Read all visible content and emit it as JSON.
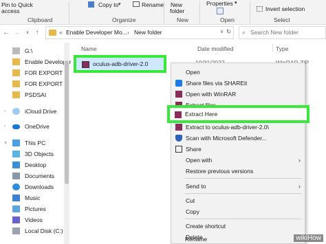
{
  "ribbon": {
    "pin_label": "Pin to Quick",
    "access_label": "access",
    "copy_to": "Copy to",
    "rename": "Rename",
    "new_label": "New",
    "folder_label": "folder",
    "properties": "Properties",
    "invert_selection": "Invert selection",
    "groups": {
      "clipboard": "Clipboard",
      "organize": "Organize",
      "new": "New",
      "open": "Open",
      "select": "Select"
    }
  },
  "address": {
    "crumb1": "Enable Developer Mo...",
    "crumb2": "New folder",
    "search_placeholder": "Search New folder"
  },
  "columns": {
    "name": "Name",
    "date_modified": "Date modified",
    "type": "Type",
    "date_value": "10/31/2022 ...",
    "type_value": "WinRAR ZIP archive"
  },
  "sidebar": {
    "items": [
      {
        "label": "G:\\"
      },
      {
        "label": "Enable Developer"
      },
      {
        "label": "FOR EXPORT"
      },
      {
        "label": "FOR EXPORT"
      },
      {
        "label": "PSDSAI"
      },
      {
        "label": "iCloud Drive"
      },
      {
        "label": "OneDrive"
      },
      {
        "label": "This PC"
      },
      {
        "label": "3D Objects"
      },
      {
        "label": "Desktop"
      },
      {
        "label": "Documents"
      },
      {
        "label": "Downloads"
      },
      {
        "label": "Music"
      },
      {
        "label": "Pictures"
      },
      {
        "label": "Videos"
      },
      {
        "label": "Local Disk (C:)"
      }
    ]
  },
  "file": {
    "name": "oculus-adb-driver-2.0"
  },
  "context_menu": {
    "items": [
      "Open",
      "Share files via SHAREit",
      "Open with WinRAR",
      "Extract files...",
      "Extract Here",
      "Extract to oculus-adb-driver-2.0\\",
      "Scan with Microsoft Defender...",
      "Share",
      "Open with",
      "Restore previous versions",
      "Send to",
      "Cut",
      "Copy",
      "Create shortcut",
      "Delete",
      "Rename"
    ]
  },
  "watermark": "wikiHow"
}
